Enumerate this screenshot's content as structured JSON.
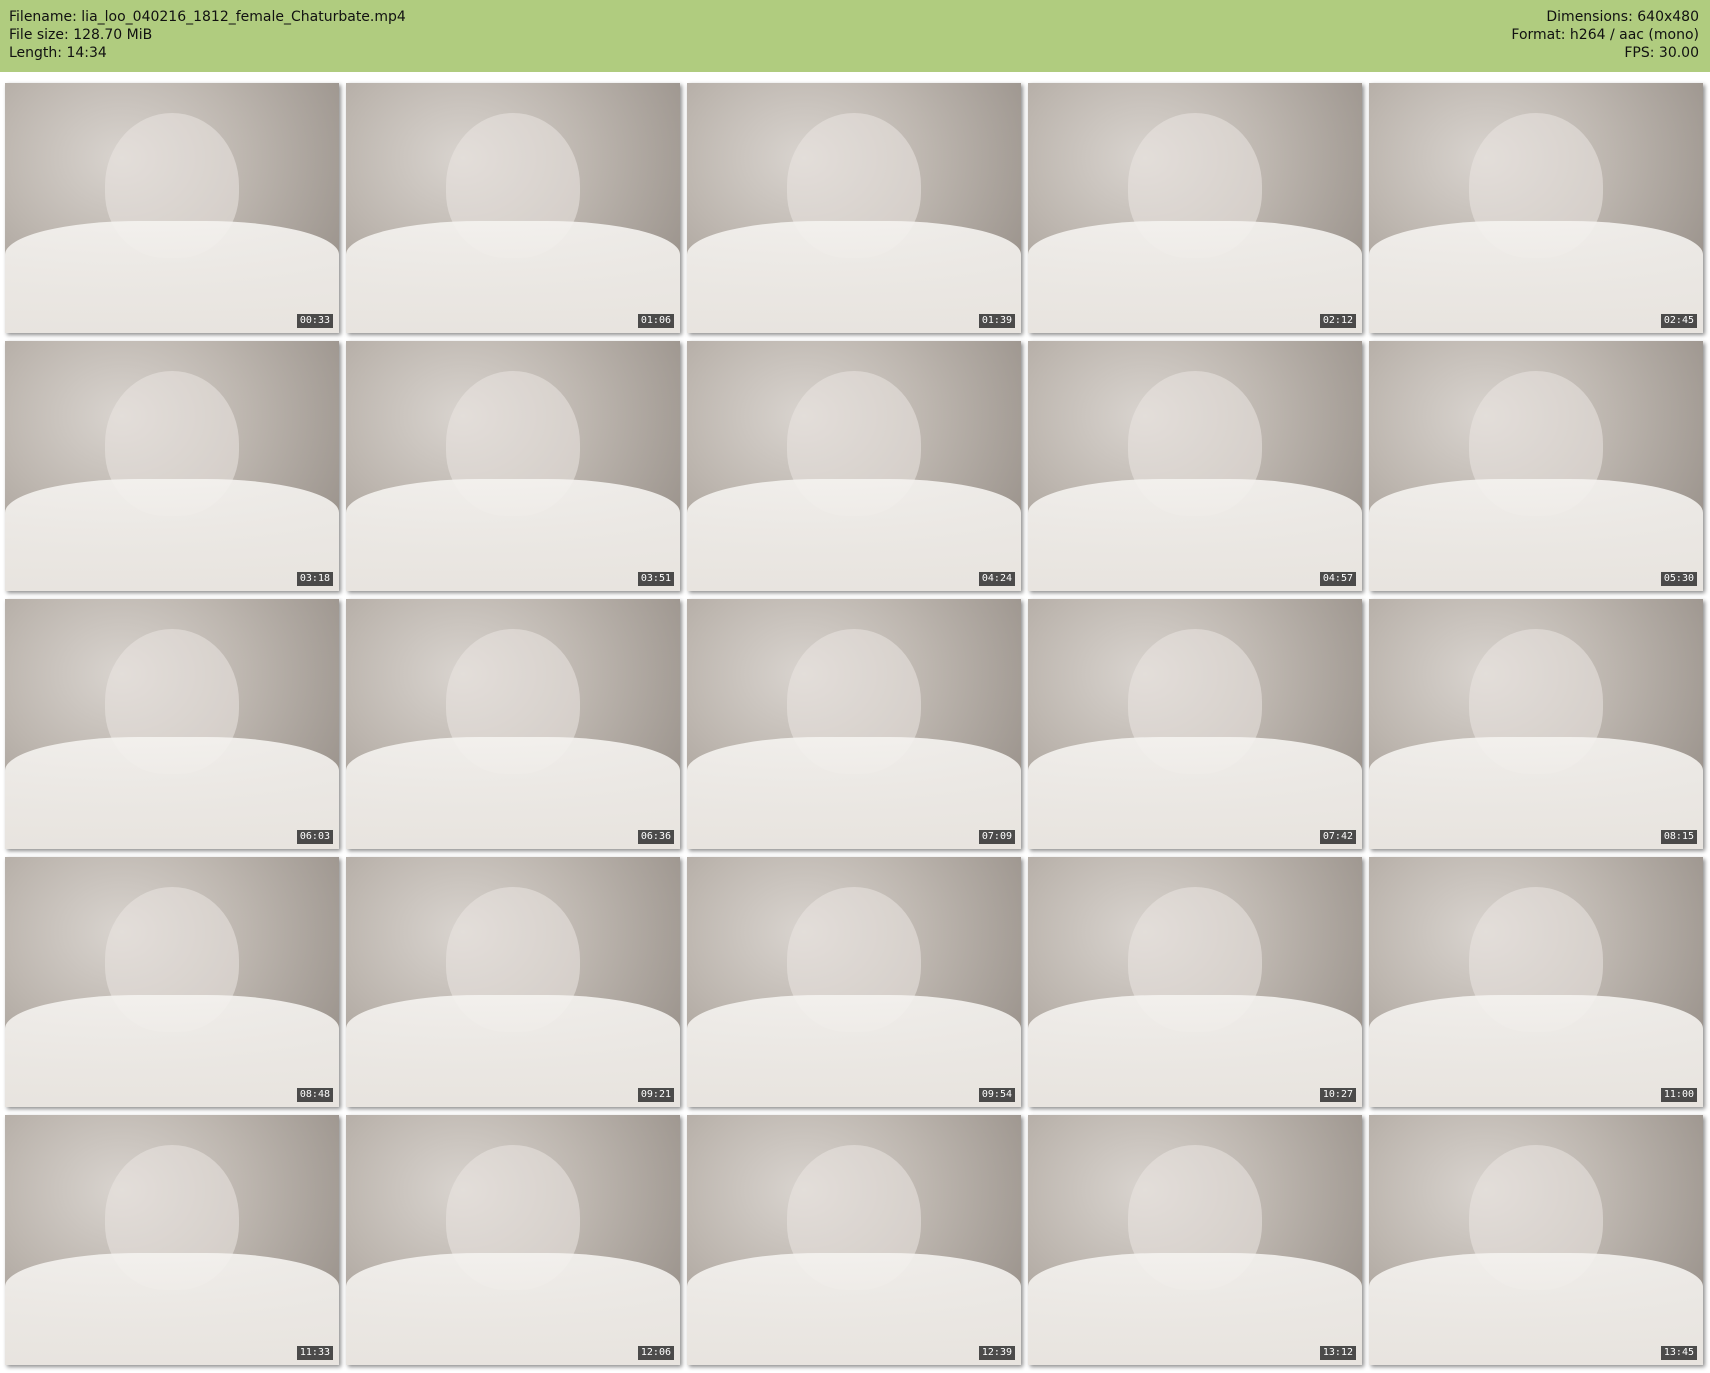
{
  "header": {
    "filename": "Filename: lia_loo_040216_1812_female_Chaturbate.mp4",
    "filesize": "File size: 128.70 MiB",
    "length": "Length: 14:34",
    "dimensions": "Dimensions: 640x480",
    "format": "Format: h264 / aac (mono)",
    "fps": "FPS: 30.00"
  },
  "thumbnails": [
    {
      "timestamp": "00:33"
    },
    {
      "timestamp": "01:06"
    },
    {
      "timestamp": "01:39"
    },
    {
      "timestamp": "02:12"
    },
    {
      "timestamp": "02:45"
    },
    {
      "timestamp": "03:18"
    },
    {
      "timestamp": "03:51"
    },
    {
      "timestamp": "04:24"
    },
    {
      "timestamp": "04:57"
    },
    {
      "timestamp": "05:30"
    },
    {
      "timestamp": "06:03"
    },
    {
      "timestamp": "06:36"
    },
    {
      "timestamp": "07:09"
    },
    {
      "timestamp": "07:42"
    },
    {
      "timestamp": "08:15"
    },
    {
      "timestamp": "08:48"
    },
    {
      "timestamp": "09:21"
    },
    {
      "timestamp": "09:54"
    },
    {
      "timestamp": "10:27"
    },
    {
      "timestamp": "11:00"
    },
    {
      "timestamp": "11:33"
    },
    {
      "timestamp": "12:06"
    },
    {
      "timestamp": "12:39"
    },
    {
      "timestamp": "13:12"
    },
    {
      "timestamp": "13:45"
    }
  ],
  "colors": {
    "header_background": "#b0cc7f",
    "timestamp_background": "#282828"
  }
}
